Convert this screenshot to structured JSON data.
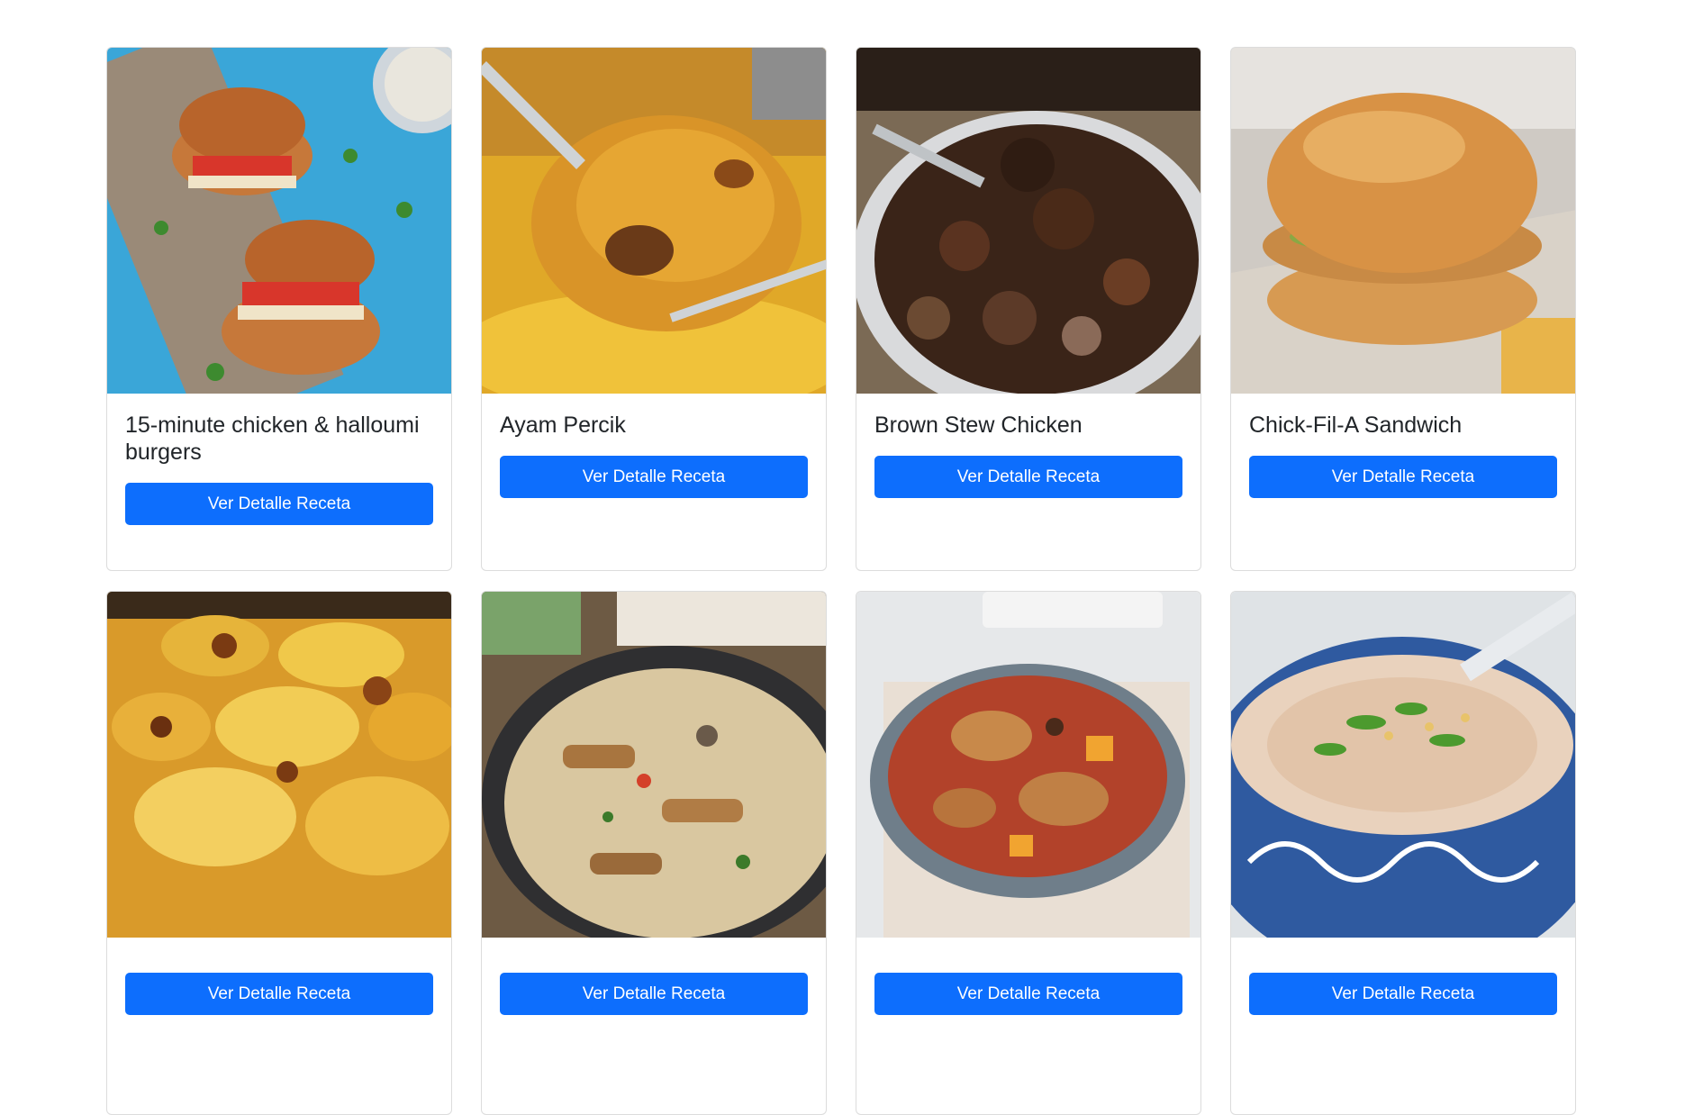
{
  "recipes": [
    {
      "title": "15-minute chicken & halloumi burgers",
      "button": "Ver Detalle Receta",
      "image": "chicken-halloumi-burgers-photo"
    },
    {
      "title": "Ayam Percik",
      "button": "Ver Detalle Receta",
      "image": "ayam-percik-photo"
    },
    {
      "title": "Brown Stew Chicken",
      "button": "Ver Detalle Receta",
      "image": "brown-stew-chicken-photo"
    },
    {
      "title": "Chick-Fil-A Sandwich",
      "button": "Ver Detalle Receta",
      "image": "chick-fil-a-sandwich-photo"
    },
    {
      "title": "",
      "button": "Ver Detalle Receta",
      "image": "potato-gratin-photo"
    },
    {
      "title": "",
      "button": "Ver Detalle Receta",
      "image": "chicken-pasta-skillet-photo"
    },
    {
      "title": "",
      "button": "Ver Detalle Receta",
      "image": "chicken-rice-casserole-photo"
    },
    {
      "title": "",
      "button": "Ver Detalle Receta",
      "image": "congee-bowl-photo"
    }
  ],
  "colors": {
    "button_bg": "#0d6efd",
    "button_text": "#ffffff",
    "title_text": "#212529",
    "card_border": "#dcdcdc"
  }
}
